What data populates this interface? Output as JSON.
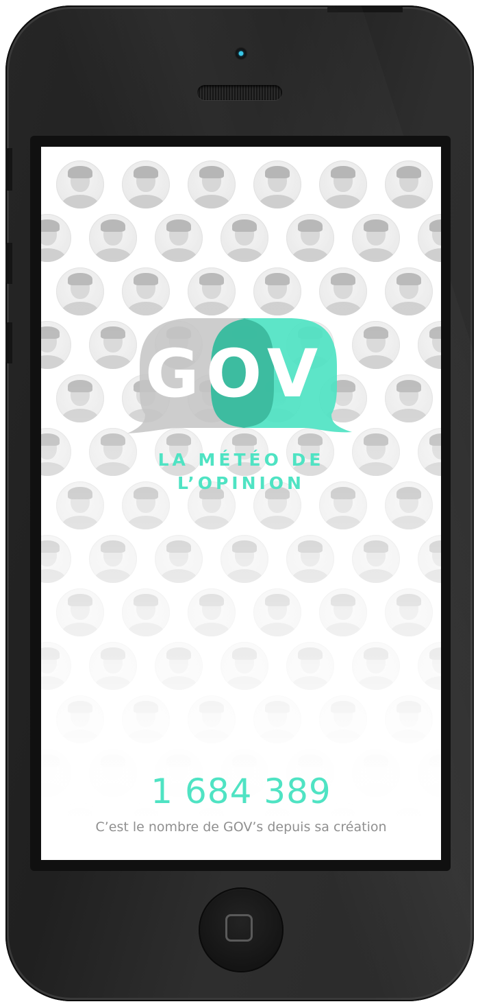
{
  "app": {
    "logo_text": "GOV",
    "logo_letters": [
      "G",
      "O",
      "V"
    ],
    "tagline_line1": "LA MÉTÉO DE",
    "tagline_line2": "L’OPINION"
  },
  "stats": {
    "count": "1 684 389",
    "caption": "C’est le nombre de GOV’s depuis sa création"
  },
  "colors": {
    "accent": "#4fe3c3",
    "bubble_gray": "#c4c4c4",
    "caption_gray": "#8f8f8f",
    "device": "#222222"
  },
  "icons": {
    "home": "home-button-square",
    "camera": "front-camera",
    "speaker": "earpiece-speaker"
  }
}
